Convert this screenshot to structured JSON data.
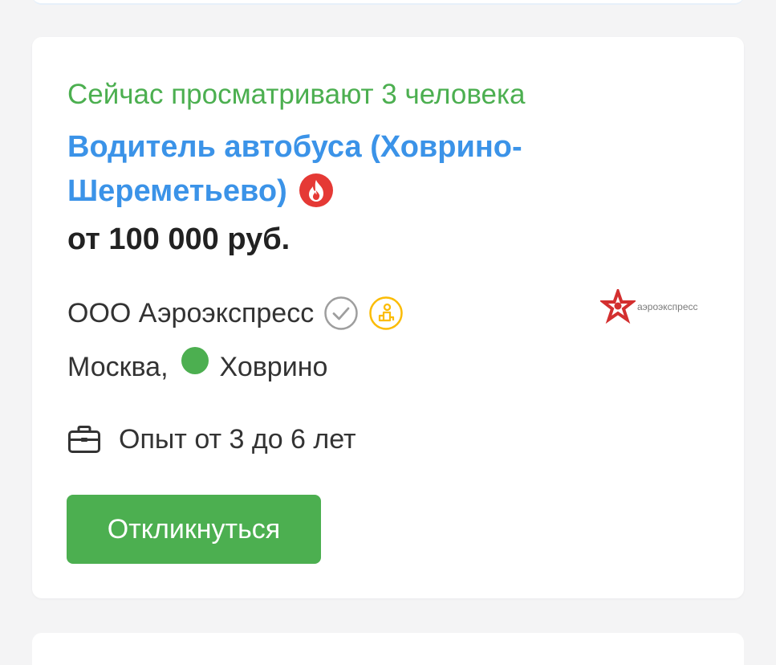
{
  "vacancy": {
    "viewers_text": "Сейчас просматривают 3 человека",
    "title": "Водитель автобуса (Ховрино-Шереметьево)",
    "salary": "от 100 000 руб.",
    "company": "ООО Аэроэкспресс",
    "company_logo_text": "аэроэкспресс",
    "city": "Москва,",
    "metro_station": "Ховрино",
    "experience": "Опыт от 3 до 6 лет",
    "respond_label": "Откликнуться"
  },
  "colors": {
    "accent_green": "#4caf50",
    "title_blue": "#3b93e8",
    "hot_red": "#e53935",
    "badge_yellow": "#fbbc05",
    "verified_gray": "#9e9e9e"
  },
  "icons": {
    "hot": "fire-icon",
    "verified": "check-circle-icon",
    "employer_badge": "person-award-icon",
    "metro": "metro-line-dot-icon",
    "experience": "briefcase-icon"
  }
}
